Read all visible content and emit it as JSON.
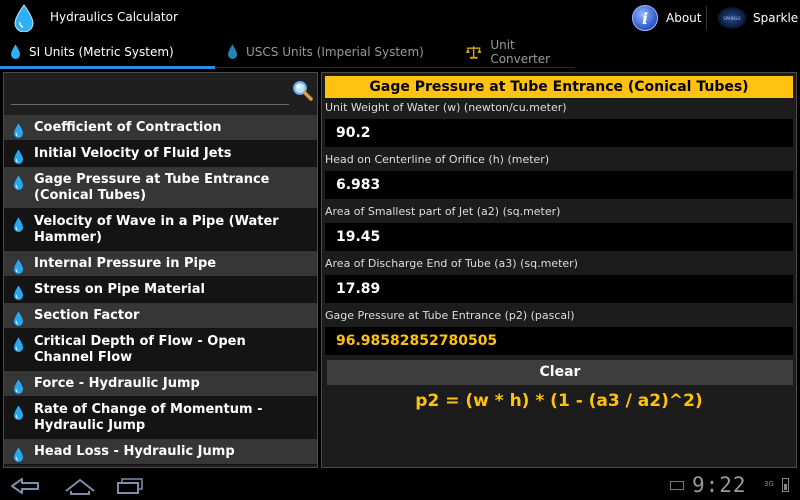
{
  "app": {
    "title": "Hydraulics Calculator",
    "about_label": "About",
    "sparkle_label": "Sparkle",
    "sparkle_logo_text": "SPARKLE"
  },
  "tabs": [
    {
      "label": "SI Units (Metric System)",
      "icon": "water-drop-icon",
      "selected": true
    },
    {
      "label": "USCS Units (Imperial System)",
      "icon": "water-drop-icon",
      "selected": false
    },
    {
      "label": "Unit Converter",
      "icon": "scales-icon",
      "selected": false
    }
  ],
  "search": {
    "value": "",
    "placeholder": ""
  },
  "list": {
    "items": [
      {
        "label": "Coefficient of Contraction"
      },
      {
        "label": "Initial Velocity of Fluid Jets"
      },
      {
        "label": "Gage Pressure at Tube Entrance (Conical Tubes)"
      },
      {
        "label": "Velocity of Wave in a Pipe (Water Hammer)"
      },
      {
        "label": "Internal Pressure in Pipe"
      },
      {
        "label": "Stress on Pipe Material"
      },
      {
        "label": "Section Factor"
      },
      {
        "label": "Critical Depth of Flow - Open Channel Flow"
      },
      {
        "label": "Force - Hydraulic Jump"
      },
      {
        "label": "Rate of Change of Momentum - Hydraulic Jump"
      },
      {
        "label": "Head Loss - Hydraulic Jump"
      }
    ]
  },
  "calculator": {
    "title": "Gage Pressure at Tube Entrance (Conical Tubes)",
    "fields": [
      {
        "label": "Unit Weight of Water (w) (newton/cu.meter)",
        "value": "90.2"
      },
      {
        "label": "Head on Centerline of Orifice (h) (meter)",
        "value": "6.983"
      },
      {
        "label": "Area of Smallest part of Jet (a2) (sq.meter)",
        "value": "19.45"
      },
      {
        "label": "Area of Discharge End of Tube (a3) (sq.meter)",
        "value": "17.89"
      },
      {
        "label": "Gage Pressure at Tube Entrance (p2) (pascal)",
        "value": "96.98582852780505"
      }
    ],
    "clear_label": "Clear",
    "formula": "p2 = (w * h) * (1 - (a3 / a2)^2)"
  },
  "system": {
    "clock": "9:22",
    "signal": "3G"
  },
  "colors": {
    "accent_yellow": "#ffc20e",
    "tab_indicator": "#2f8de0",
    "drop_blue": "#29a8f0"
  }
}
